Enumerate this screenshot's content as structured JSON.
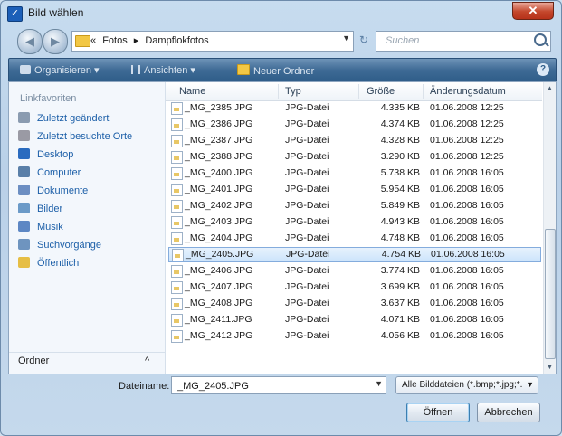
{
  "window": {
    "title": "Bild wählen",
    "close_glyph": "✕"
  },
  "address": {
    "overflow": "«",
    "crumbs": [
      "Fotos",
      "Dampflokfotos"
    ],
    "separator": "▸",
    "search_placeholder": "Suchen"
  },
  "toolbar": {
    "organize": "Organisieren",
    "views": "Ansichten",
    "new_folder": "Neuer Ordner"
  },
  "nav": {
    "heading": "Linkfavoriten",
    "items": [
      {
        "label": "Zuletzt geändert",
        "icon": "recent-docs-icon",
        "color": "#8a9bb0"
      },
      {
        "label": "Zuletzt besuchte Orte",
        "icon": "recent-places-icon",
        "color": "#9a9aa4"
      },
      {
        "label": "Desktop",
        "icon": "desktop-icon",
        "color": "#2a6bbf"
      },
      {
        "label": "Computer",
        "icon": "computer-icon",
        "color": "#5a7fa8"
      },
      {
        "label": "Dokumente",
        "icon": "documents-icon",
        "color": "#6c8ec2"
      },
      {
        "label": "Bilder",
        "icon": "pictures-icon",
        "color": "#6b9ac8"
      },
      {
        "label": "Musik",
        "icon": "music-icon",
        "color": "#5d87c4"
      },
      {
        "label": "Suchvorgänge",
        "icon": "searches-icon",
        "color": "#6e94bf"
      },
      {
        "label": "Öffentlich",
        "icon": "public-folder-icon",
        "color": "#e6be45"
      }
    ],
    "footer": "Ordner",
    "footer_glyph": "^"
  },
  "files": {
    "columns": [
      "Name",
      "Typ",
      "Größe",
      "Änderungsdatum"
    ],
    "rows": [
      [
        "_MG_2385.JPG",
        "JPG-Datei",
        "4.335 KB",
        "01.06.2008 12:25"
      ],
      [
        "_MG_2386.JPG",
        "JPG-Datei",
        "4.374 KB",
        "01.06.2008 12:25"
      ],
      [
        "_MG_2387.JPG",
        "JPG-Datei",
        "4.328 KB",
        "01.06.2008 12:25"
      ],
      [
        "_MG_2388.JPG",
        "JPG-Datei",
        "3.290 KB",
        "01.06.2008 12:25"
      ],
      [
        "_MG_2400.JPG",
        "JPG-Datei",
        "5.738 KB",
        "01.06.2008 16:05"
      ],
      [
        "_MG_2401.JPG",
        "JPG-Datei",
        "5.954 KB",
        "01.06.2008 16:05"
      ],
      [
        "_MG_2402.JPG",
        "JPG-Datei",
        "5.849 KB",
        "01.06.2008 16:05"
      ],
      [
        "_MG_2403.JPG",
        "JPG-Datei",
        "4.943 KB",
        "01.06.2008 16:05"
      ],
      [
        "_MG_2404.JPG",
        "JPG-Datei",
        "4.748 KB",
        "01.06.2008 16:05"
      ],
      [
        "_MG_2405.JPG",
        "JPG-Datei",
        "4.754 KB",
        "01.06.2008 16:05"
      ],
      [
        "_MG_2406.JPG",
        "JPG-Datei",
        "3.774 KB",
        "01.06.2008 16:05"
      ],
      [
        "_MG_2407.JPG",
        "JPG-Datei",
        "3.699 KB",
        "01.06.2008 16:05"
      ],
      [
        "_MG_2408.JPG",
        "JPG-Datei",
        "3.637 KB",
        "01.06.2008 16:05"
      ],
      [
        "_MG_2411.JPG",
        "JPG-Datei",
        "4.071 KB",
        "01.06.2008 16:05"
      ],
      [
        "_MG_2412.JPG",
        "JPG-Datei",
        "4.056 KB",
        "01.06.2008 16:05"
      ]
    ],
    "selected": "_MG_2405.JPG"
  },
  "bottom": {
    "filename_label": "Dateiname:",
    "filename_value": "_MG_2405.JPG",
    "filter": "Alle Bilddateien (*.bmp;*.jpg;*.",
    "open": "Öffnen",
    "cancel": "Abbrechen"
  }
}
